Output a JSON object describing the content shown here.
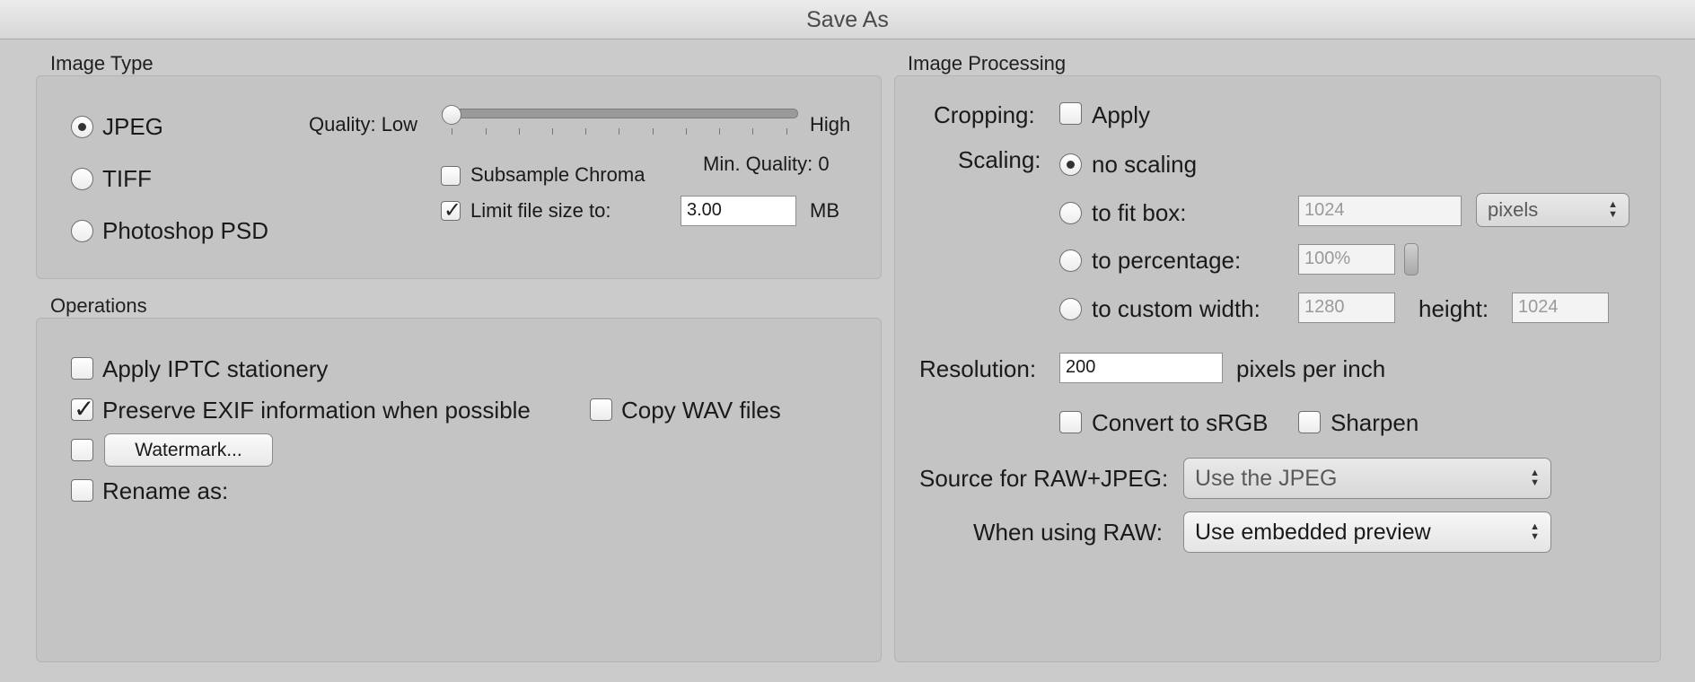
{
  "window": {
    "title": "Save As"
  },
  "image_type": {
    "label": "Image Type",
    "formats": [
      {
        "label": "JPEG",
        "selected": true
      },
      {
        "label": "TIFF",
        "selected": false
      },
      {
        "label": "Photoshop PSD",
        "selected": false
      }
    ],
    "quality": {
      "label": "Quality: Low",
      "high_label": "High",
      "value": 0,
      "min_quality": "Min. Quality: 0"
    },
    "subsample_chroma": {
      "label": "Subsample Chroma",
      "checked": false
    },
    "limit_size": {
      "label": "Limit file size to:",
      "checked": true,
      "value": "3.00",
      "unit": "MB"
    }
  },
  "operations": {
    "label": "Operations",
    "apply_iptc": {
      "label": "Apply IPTC stationery",
      "checked": false
    },
    "preserve_exif": {
      "label": "Preserve EXIF information when possible",
      "checked": true
    },
    "copy_wav": {
      "label": "Copy WAV files",
      "checked": false
    },
    "watermark": {
      "checked": false,
      "button_label": "Watermark..."
    },
    "rename": {
      "label": "Rename as:",
      "checked": false
    }
  },
  "processing": {
    "label": "Image Processing",
    "cropping": {
      "label": "Cropping:",
      "apply_label": "Apply",
      "checked": false
    },
    "scaling": {
      "label": "Scaling:",
      "no_scaling": "no scaling",
      "fit_box": {
        "label": "to fit box:",
        "value": "1024",
        "unit": "pixels"
      },
      "percentage": {
        "label": "to percentage:",
        "value": "100%"
      },
      "custom": {
        "label": "to custom width:",
        "width": "1280",
        "height_label": "height:",
        "height": "1024"
      }
    },
    "resolution": {
      "label": "Resolution:",
      "value": "200",
      "unit": "pixels per inch"
    },
    "convert_srgb": {
      "label": "Convert to sRGB",
      "checked": false
    },
    "sharpen": {
      "label": "Sharpen",
      "checked": false
    },
    "source_raw_jpeg": {
      "label": "Source for RAW+JPEG:",
      "value": "Use the JPEG"
    },
    "when_raw": {
      "label": "When using RAW:",
      "value": "Use embedded preview"
    }
  }
}
